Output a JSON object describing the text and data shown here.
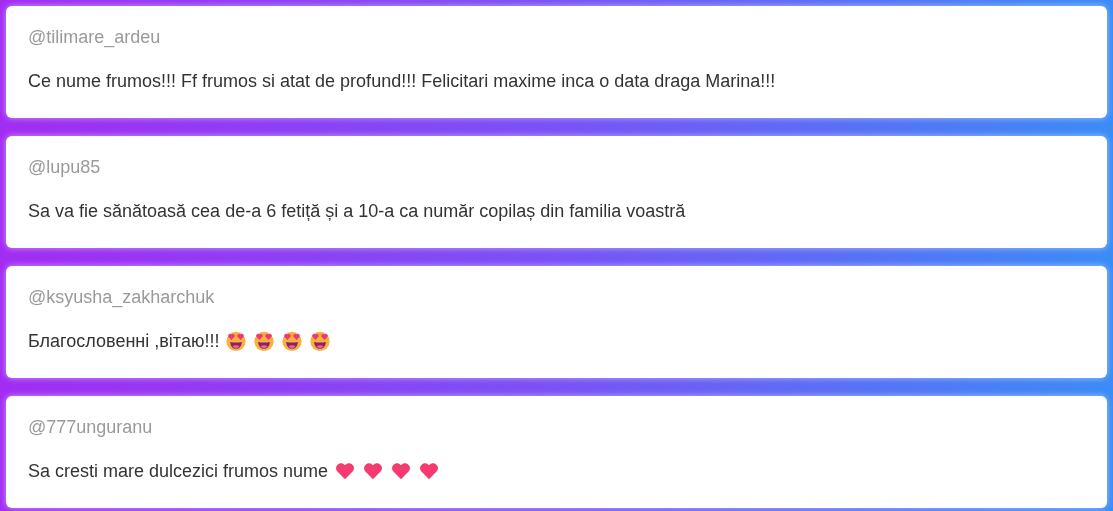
{
  "comments": [
    {
      "username": "@tilimare_ardeu",
      "text": "Ce nume frumos!!! Ff frumos si atat de profund!!! Felicitari maxime inca o data draga Marina!!!"
    },
    {
      "username": "@lupu85",
      "text": "Sa va fie sănătoasă cea de-a 6 fetiță și a 10-a ca număr copilaș din familia voastră"
    },
    {
      "username": "@ksyusha_zakharchuk",
      "text": "Благословенні ,вітаю!!!",
      "emojis": [
        {
          "kind": "heart-eyes"
        },
        {
          "kind": "heart-eyes"
        },
        {
          "kind": "heart-eyes"
        },
        {
          "kind": "heart-eyes"
        }
      ]
    },
    {
      "username": "@777unguranu",
      "text": "Sa cresti mare dulcezici frumos nume",
      "emojis": [
        {
          "kind": "heart"
        },
        {
          "kind": "heart"
        },
        {
          "kind": "heart"
        },
        {
          "kind": "heart"
        }
      ]
    }
  ]
}
